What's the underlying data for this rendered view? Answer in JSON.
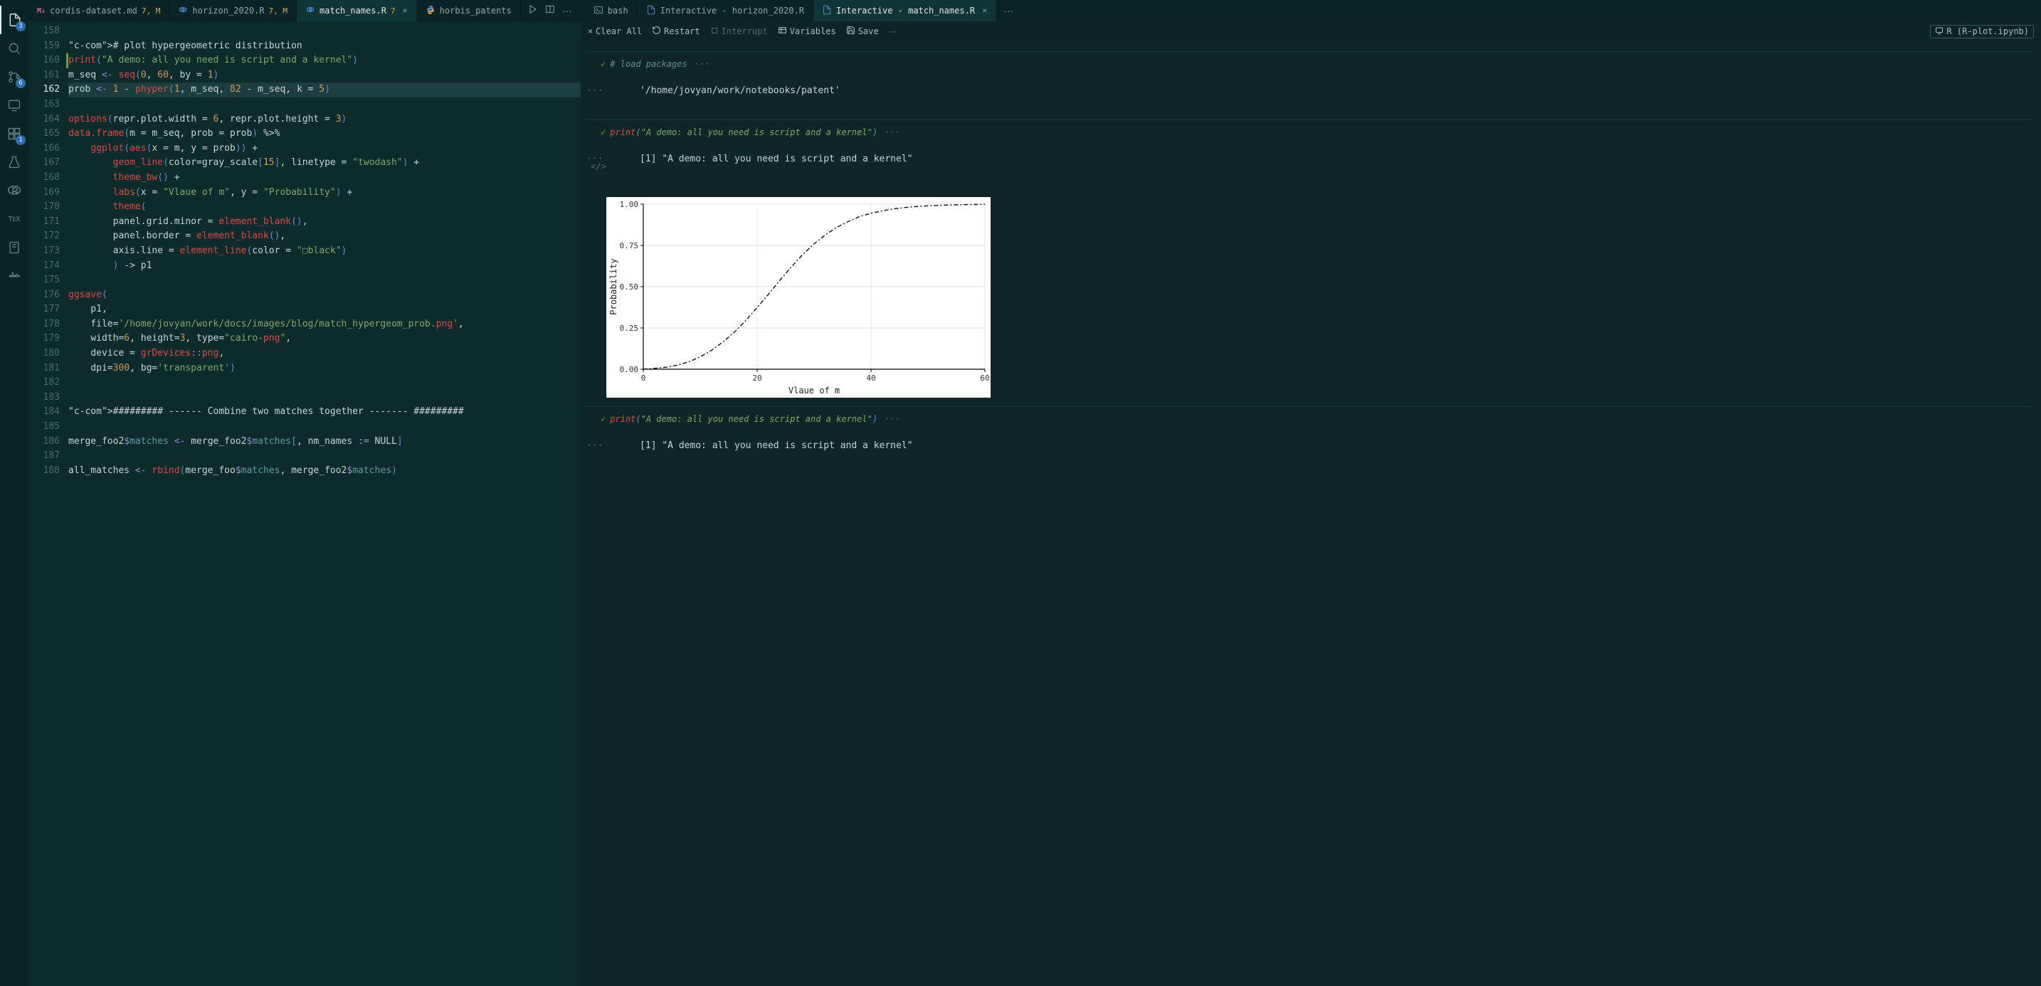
{
  "activity": {
    "badges": {
      "explorer": "3",
      "scm": "6",
      "ext": "1"
    }
  },
  "tabs": {
    "left": [
      {
        "icon": "M↓",
        "icon_color": "#d16b8c",
        "name": "cordis-dataset.md",
        "status": "7, M",
        "active": false
      },
      {
        "icon": "R",
        "icon_color": "#4a8fd6",
        "name": "horizon_2020.R",
        "status": "7, M",
        "active": false
      },
      {
        "icon": "R",
        "icon_color": "#4a8fd6",
        "name": "match_names.R",
        "status": "7",
        "active": true,
        "close": true
      },
      {
        "icon": "py",
        "icon_color": "#d9a45b",
        "name": "horbis_patents",
        "status": "",
        "active": false
      }
    ],
    "right": [
      {
        "icon": "term",
        "name": "bash",
        "active": false
      },
      {
        "icon": "file",
        "name": "Interactive - horizon_2020.R",
        "active": false
      },
      {
        "icon": "file",
        "name": "Interactive - match_names.R",
        "active": true,
        "close": true
      }
    ]
  },
  "toolbar": {
    "clear": "Clear All",
    "restart": "Restart",
    "interrupt": "Interrupt",
    "variables": "Variables",
    "save": "Save",
    "kernel": "R (R-plot.ipynb)"
  },
  "editor": {
    "start_line": 158,
    "current_line": 162,
    "lines": [
      "",
      "# plot hypergeometric distribution",
      "print(\"A demo: all you need is script and a kernel\")",
      "m_seq <- seq(0, 60, by = 1)",
      "prob <- 1 - phyper(1, m_seq, 82 - m_seq, k = 5)",
      "",
      "options(repr.plot.width = 6, repr.plot.height = 3)",
      "data.frame(m = m_seq, prob = prob) %>%",
      "    ggplot(aes(x = m, y = prob)) +",
      "        geom_line(color=gray_scale[15], linetype = \"twodash\") +",
      "        theme_bw() +",
      "        labs(x = \"Vlaue of m\", y = \"Probability\") +",
      "        theme(",
      "        panel.grid.minor = element_blank(),",
      "        panel.border = element_blank(),",
      "        axis.line = element_line(color = \"▢black\")",
      "        ) -> p1",
      "",
      "ggsave(",
      "    p1,",
      "    file='/home/jovyan/work/docs/images/blog/match_hypergeom_prob.png',",
      "    width=6, height=3, type=\"cairo-png\",",
      "    device = grDevices::png,",
      "    dpi=300, bg='transparent')",
      "",
      "",
      "######### ------ Combine two matches together ------- #########",
      "",
      "merge_foo2$matches <- merge_foo2$matches[, nm_names := NULL]",
      "",
      "all_matches <- rbind(merge_foo$matches, merge_foo2$matches)"
    ]
  },
  "cells": {
    "c0": {
      "label": "# load packages",
      "out_prefix": "···",
      "out": "'/home/jovyan/work/notebooks/patent'"
    },
    "c1": {
      "call": "print",
      "arg": "\"A demo: all you need is script and a kernel\"",
      "out_prefix": "···",
      "out": "[1] \"A demo: all you need is script and a kernel\""
    },
    "c2": {
      "call": "print",
      "arg": "\"A demo: all you need is script and a kernel\"",
      "out_prefix": "···",
      "out": "[1] \"A demo: all you need is script and a kernel\""
    }
  },
  "chart_data": {
    "type": "line",
    "title": "",
    "xlabel": "Vlaue of m",
    "ylabel": "Probability",
    "xlim": [
      0,
      60
    ],
    "ylim": [
      0,
      1
    ],
    "xticks": [
      0,
      20,
      40,
      60
    ],
    "yticks": [
      0.0,
      0.25,
      0.5,
      0.75,
      1.0
    ],
    "linetype": "twodash",
    "x": [
      0,
      2,
      4,
      6,
      8,
      10,
      12,
      14,
      16,
      18,
      20,
      22,
      24,
      26,
      28,
      30,
      32,
      34,
      36,
      38,
      40,
      42,
      44,
      46,
      48,
      50,
      52,
      54,
      56,
      58,
      60
    ],
    "y": [
      0.0,
      0.005,
      0.012,
      0.025,
      0.045,
      0.075,
      0.115,
      0.165,
      0.225,
      0.295,
      0.375,
      0.455,
      0.54,
      0.62,
      0.695,
      0.76,
      0.815,
      0.86,
      0.895,
      0.925,
      0.945,
      0.96,
      0.972,
      0.98,
      0.986,
      0.99,
      0.993,
      0.995,
      0.997,
      0.998,
      0.999
    ]
  }
}
